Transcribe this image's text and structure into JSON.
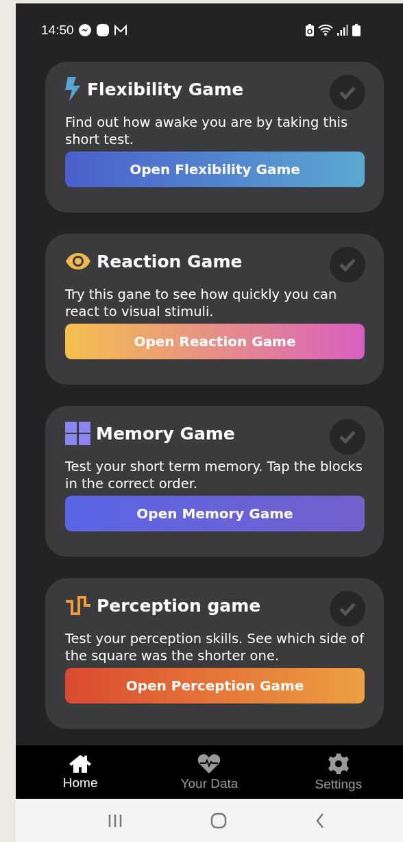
{
  "status_bar": {
    "time": "14:50"
  },
  "games": [
    {
      "kind": "bolt",
      "title": "Flexibility Game",
      "completed": false,
      "description": "Find out how awake you are by taking this short test.",
      "button": "Open Flexibility Game"
    },
    {
      "kind": "eye",
      "title": "Reaction Game",
      "completed": false,
      "description": "Try this gane to see how quickly you can react to visual stimuli.",
      "button": "Open Reaction Game"
    },
    {
      "kind": "grid",
      "title": "Memory Game",
      "completed": false,
      "description": "Test your short term memory. Tap the blocks in the correct order.",
      "button": "Open Memory Game"
    },
    {
      "kind": "pulse",
      "title": "Perception game",
      "completed": false,
      "description": "Test your perception skills. See which side of the square was the shorter one.",
      "button": "Open Perception Game"
    }
  ],
  "bottom_nav": [
    {
      "kind": "home",
      "label": "Home",
      "selected": true
    },
    {
      "kind": "heart",
      "label": "Your Data",
      "selected": false
    },
    {
      "kind": "gear",
      "label": "Settings",
      "selected": false
    }
  ]
}
